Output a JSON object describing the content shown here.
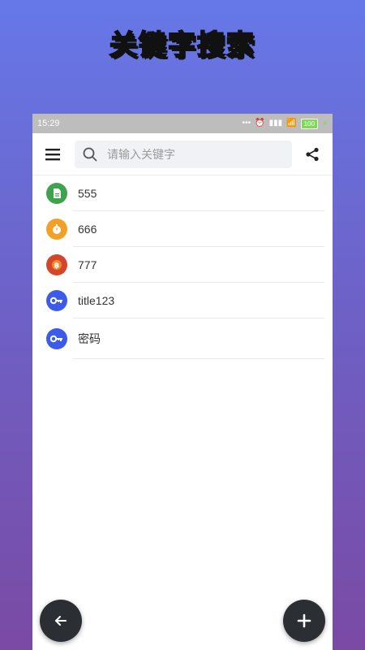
{
  "banner": {
    "title": "关键字搜索"
  },
  "status_bar": {
    "time": "15:29",
    "battery": "100"
  },
  "toolbar": {
    "search_placeholder": "请输入关键字"
  },
  "items": [
    {
      "label": "555",
      "icon": "document-icon",
      "color": "#3fa34d"
    },
    {
      "label": "666",
      "icon": "stopwatch-icon",
      "color": "#f2a127"
    },
    {
      "label": "777",
      "icon": "bitcoin-icon",
      "color": "#d4452a"
    },
    {
      "label": "title123",
      "icon": "key-icon",
      "color": "#3c5bea"
    },
    {
      "label": "密码",
      "icon": "key-icon",
      "color": "#3c5bea"
    }
  ]
}
